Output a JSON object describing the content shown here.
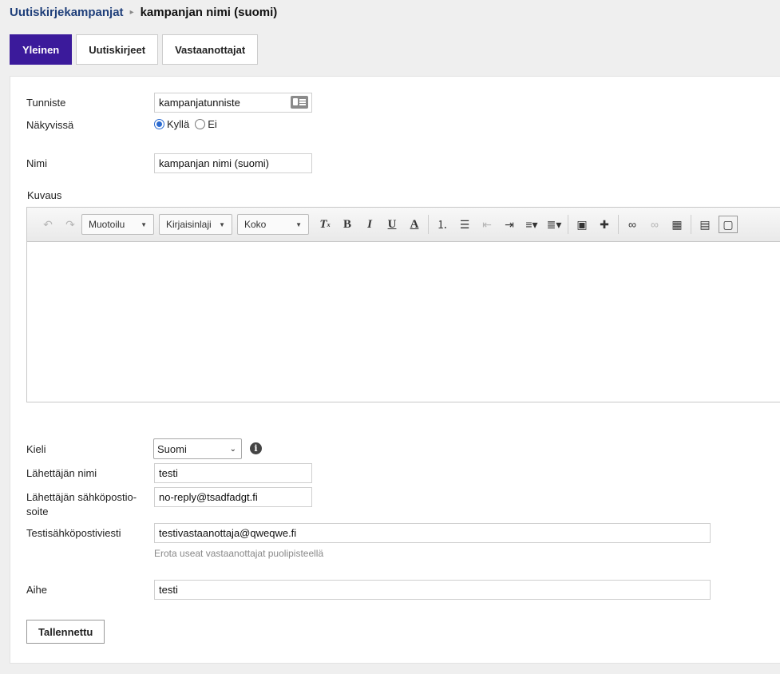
{
  "breadcrumb": {
    "parent": "Uutiskirjekampanjat",
    "separator": "▸",
    "current": "kampanjan nimi (suomi)"
  },
  "tabs": [
    {
      "label": "Yleinen",
      "active": true
    },
    {
      "label": "Uutiskirjeet",
      "active": false
    },
    {
      "label": "Vastaanottajat",
      "active": false
    }
  ],
  "form": {
    "identifier": {
      "label": "Tunniste",
      "value": "kampanjatunniste",
      "icon": "id-card-icon"
    },
    "visible": {
      "label": "Näkyvissä",
      "options": [
        "Kyllä",
        "Ei"
      ],
      "selected": "Kyllä"
    },
    "name": {
      "label": "Nimi",
      "value": "kampanjan nimi (suomi)"
    },
    "description": {
      "label": "Kuvaus",
      "toolbar": {
        "format": "Muotoilu",
        "font": "Kirjaisinlaji",
        "size": "Koko"
      },
      "content": ""
    },
    "language": {
      "label": "Kieli",
      "value": "Suomi"
    },
    "sender_name": {
      "label": "Lähettäjän nimi",
      "value": "testi"
    },
    "sender_email": {
      "label_line1": "Lähettäjän sähköpostio-",
      "label_line2": "soite",
      "value": "no-reply@tsadfadgt.fi"
    },
    "test_email": {
      "label": "Testisähköpostiviesti",
      "value": "testivastaanottaja@qweqwe.fi",
      "hint": "Erota useat vastaanottajat puolipisteellä"
    },
    "subject": {
      "label": "Aihe",
      "value": "testi"
    },
    "save_label": "Tallennettu"
  },
  "colors": {
    "active_tab": "#3b1a9b",
    "link": "#1f3f7a",
    "radio": "#2a6ad0"
  }
}
